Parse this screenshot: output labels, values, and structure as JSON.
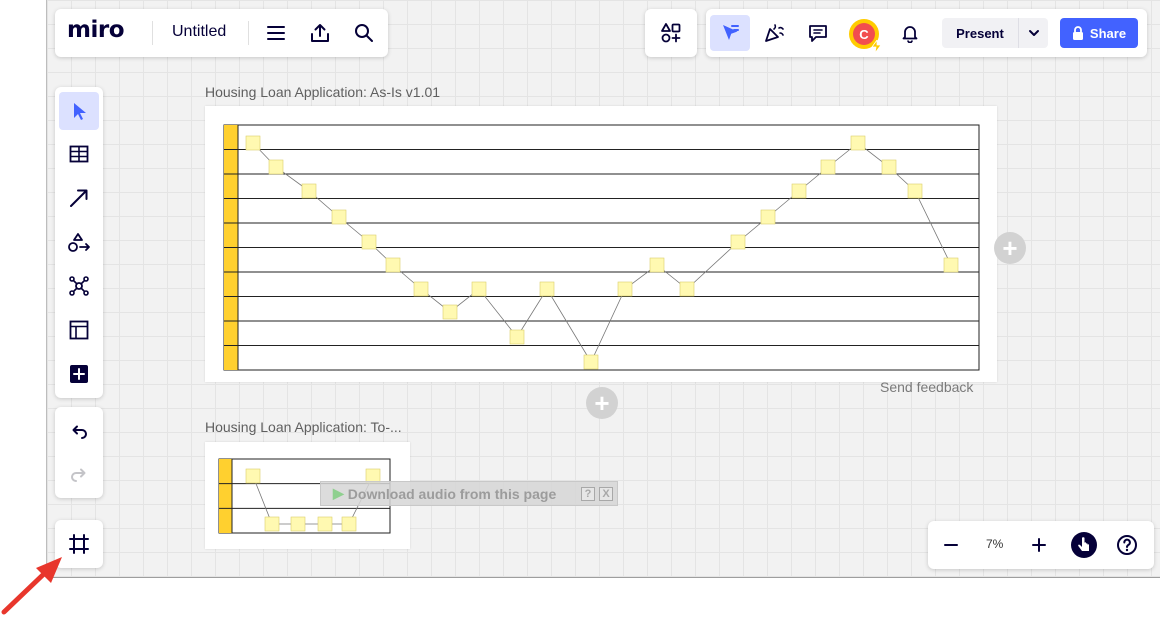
{
  "app": {
    "logo_text": "miro",
    "board_title": "Untitled"
  },
  "top_left_toolbar": {
    "icons": [
      "menu-icon",
      "export-icon",
      "search-icon"
    ]
  },
  "top_right_toolbar": {
    "icons": [
      "apps-icon",
      "cursor-select-icon",
      "celebrate-icon",
      "comments-icon",
      "notifications-icon"
    ],
    "avatar_initial": "C",
    "present_label": "Present",
    "share_label": "Share"
  },
  "left_toolbar": {
    "tools": [
      "select-tool-icon",
      "table-tool-icon",
      "arrow-tool-icon",
      "shapes-tool-icon",
      "mind-map-icon",
      "frame-template-icon",
      "add-more-icon"
    ],
    "history": [
      "undo-icon",
      "redo-icon"
    ],
    "frames_tool": "frames-icon"
  },
  "board": {
    "frames": [
      {
        "title": "Housing Loan Application: As-Is v1.01",
        "lanes": 10
      },
      {
        "title": "Housing Loan Application: To-...",
        "lanes": 3
      }
    ],
    "send_feedback": "Send feedback"
  },
  "zoom": {
    "level": "7%",
    "minus": "−",
    "plus": "+"
  },
  "overlay": {
    "audio_text": "Download audio from this page",
    "help": "?",
    "close": "X"
  },
  "colors": {
    "brand_blue": "#4262ff",
    "lane_header_yellow": "#ffd02f",
    "sticky_yellow": "#fff9b1",
    "annotation_arrow": "#e8362c"
  }
}
